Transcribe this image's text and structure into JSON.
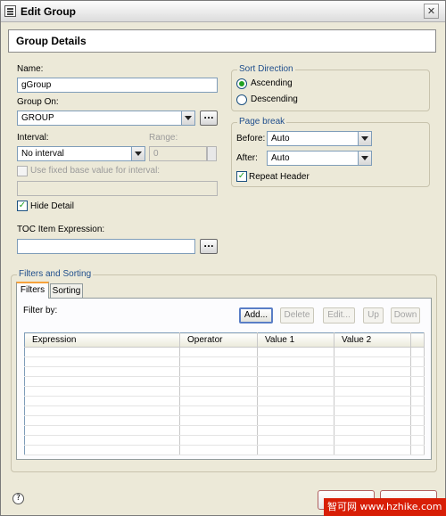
{
  "window": {
    "title": "Edit Group",
    "close_glyph": "✕"
  },
  "header": {
    "title": "Group Details"
  },
  "general": {
    "name_label": "Name:",
    "name_value": "gGroup",
    "group_on_label": "Group On:",
    "group_on_value": "GROUP",
    "interval_label": "Interval:",
    "interval_value": "No interval",
    "range_label": "Range:",
    "range_value": "0",
    "fixed_base_label": "Use fixed base value for interval:",
    "fixed_base_value": "",
    "hide_detail_label": "Hide Detail",
    "hide_detail_checked": true,
    "toc_label": "TOC Item Expression:",
    "toc_value": "",
    "ellipsis": "..."
  },
  "sort_direction": {
    "title": "Sort Direction",
    "options": [
      "Ascending",
      "Descending"
    ],
    "selected": "Ascending"
  },
  "page_break": {
    "title": "Page break",
    "before_label": "Before:",
    "before_value": "Auto",
    "after_label": "After:",
    "after_value": "Auto",
    "repeat_header_label": "Repeat Header",
    "repeat_header_checked": true
  },
  "filters_sorting": {
    "title": "Filters and Sorting",
    "tabs": [
      "Filters",
      "Sorting"
    ],
    "active_tab": "Filters",
    "filter_by_label": "Filter by:",
    "buttons": {
      "add": "Add...",
      "delete": "Delete",
      "edit": "Edit...",
      "up": "Up",
      "down": "Down"
    },
    "columns": [
      "Expression",
      "Operator",
      "Value 1",
      "Value 2"
    ],
    "rows": []
  },
  "footer": {
    "help_glyph": "?"
  },
  "watermark": {
    "text": "智可网 www.hzhike.com"
  },
  "colors": {
    "group_title": "#1f4e8c",
    "check": "#21a121",
    "tab_accent": "#f7a23b"
  }
}
